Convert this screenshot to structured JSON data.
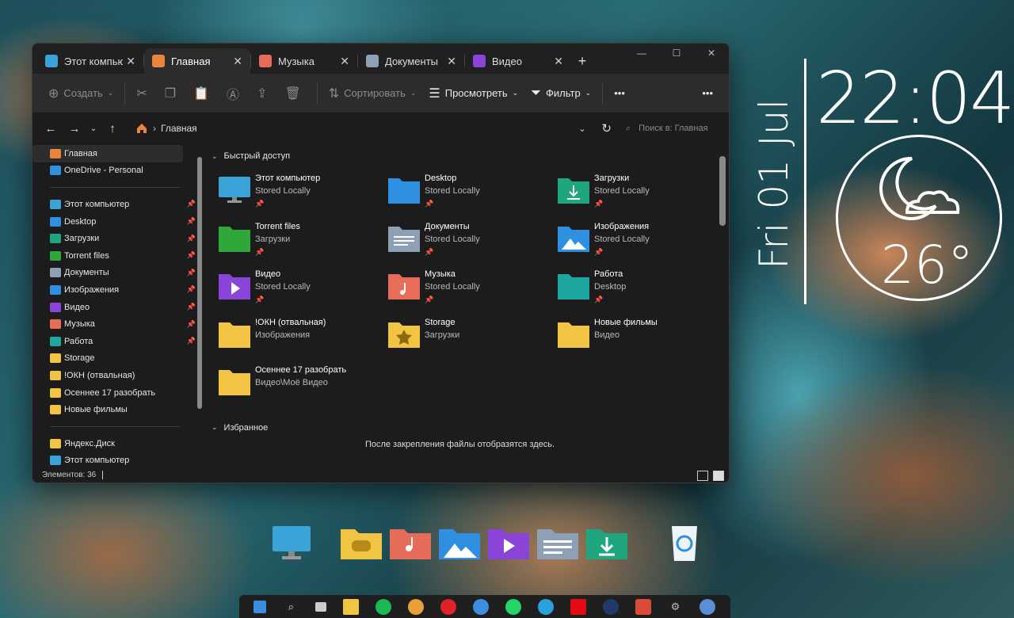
{
  "tabs": [
    {
      "label": "Этот компьютер",
      "icon": "monitor-icon"
    },
    {
      "label": "Главная",
      "icon": "home-icon",
      "active": true
    },
    {
      "label": "Музыка",
      "icon": "music-icon"
    },
    {
      "label": "Документы",
      "icon": "document-icon"
    },
    {
      "label": "Видео",
      "icon": "video-icon"
    }
  ],
  "toolbar": {
    "create": "Создать",
    "sort": "Сортировать",
    "view": "Просмотреть",
    "filter": "Фильтр",
    "more": "•••"
  },
  "address": {
    "breadcrumb": "Главная",
    "search_placeholder": "Поиск в: Главная"
  },
  "sidebar": {
    "top": [
      {
        "label": "Главная",
        "color": "#e8843c"
      },
      {
        "label": "OneDrive - Personal",
        "color": "#2f8fe0"
      }
    ],
    "pinned": [
      {
        "label": "Этот компьютер",
        "color": "#3aa4d8"
      },
      {
        "label": "Desktop",
        "color": "#2f8fe0"
      },
      {
        "label": "Загрузки",
        "color": "#1fa67f"
      },
      {
        "label": "Torrent files",
        "color": "#2fa83a"
      },
      {
        "label": "Документы",
        "color": "#8da0b5"
      },
      {
        "label": "Изображения",
        "color": "#2f8fe0"
      },
      {
        "label": "Видео",
        "color": "#8a44d8"
      },
      {
        "label": "Музыка",
        "color": "#e66c5a"
      },
      {
        "label": "Работа",
        "color": "#1fa6a0"
      },
      {
        "label": "Storage",
        "color": "#f2c443"
      },
      {
        "label": "!ОКН (отвальная)",
        "color": "#f2c443"
      },
      {
        "label": "Осеннее 17 разобрать",
        "color": "#f2c443"
      },
      {
        "label": "Новые фильмы",
        "color": "#f2c443"
      }
    ],
    "bottom": [
      {
        "label": "Яндекс.Диск",
        "color": "#f2c443"
      },
      {
        "label": "Этот компьютер",
        "color": "#3aa4d8"
      }
    ]
  },
  "quick_access": {
    "title": "Быстрый доступ",
    "items": [
      {
        "name": "Этот компьютер",
        "sub": "Stored Locally",
        "pinned": true,
        "color": "#3aa4d8",
        "icon": "monitor-icon"
      },
      {
        "name": "Desktop",
        "sub": "Stored Locally",
        "pinned": true,
        "color": "#2f8fe0",
        "icon": "folder-icon"
      },
      {
        "name": "Загрузки",
        "sub": "Stored Locally",
        "pinned": true,
        "color": "#1fa67f",
        "icon": "download-folder-icon"
      },
      {
        "name": "Torrent files",
        "sub": "Загрузки",
        "pinned": true,
        "color": "#2fa83a",
        "icon": "folder-icon"
      },
      {
        "name": "Документы",
        "sub": "Stored Locally",
        "pinned": true,
        "color": "#8da0b5",
        "icon": "document-folder-icon"
      },
      {
        "name": "Изображения",
        "sub": "Stored Locally",
        "pinned": true,
        "color": "#2f8fe0",
        "icon": "pictures-folder-icon"
      },
      {
        "name": "Видео",
        "sub": "Stored Locally",
        "pinned": true,
        "color": "#8a44d8",
        "icon": "video-folder-icon"
      },
      {
        "name": "Музыка",
        "sub": "Stored Locally",
        "pinned": true,
        "color": "#e66c5a",
        "icon": "music-folder-icon"
      },
      {
        "name": "Работа",
        "sub": "Desktop",
        "pinned": true,
        "color": "#1fa6a0",
        "icon": "folder-icon"
      },
      {
        "name": "!ОКН (отвальная)",
        "sub": "Изображения",
        "pinned": false,
        "color": "#f2c443",
        "icon": "folder-icon"
      },
      {
        "name": "Storage",
        "sub": "Загрузки",
        "pinned": false,
        "color": "#f2c443",
        "icon": "star-folder-icon"
      },
      {
        "name": "Новые фильмы",
        "sub": "Видео",
        "pinned": false,
        "color": "#f2c443",
        "icon": "folder-icon"
      },
      {
        "name": "Осеннее 17 разобрать",
        "sub": "Видео\\Моё Видео",
        "pinned": false,
        "color": "#f2c443",
        "icon": "folder-icon"
      }
    ]
  },
  "favorites": {
    "title": "Избранное",
    "empty_text": "После закрепления файлы отобразятся здесь."
  },
  "status": {
    "items": "Элементов: 36"
  },
  "widget": {
    "time": "22:04",
    "date": "Fri 01 Jul",
    "temperature": "26°"
  }
}
